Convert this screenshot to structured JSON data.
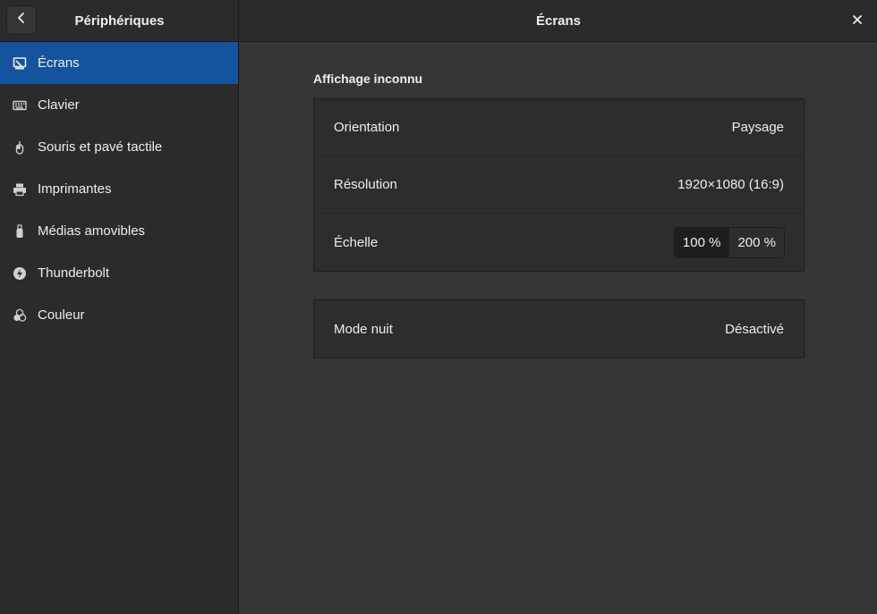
{
  "header": {
    "sidebar_title": "Périphériques",
    "main_title": "Écrans",
    "back_icon": "chevron-left-icon",
    "close_icon": "close-icon"
  },
  "sidebar": {
    "items": [
      {
        "label": "Écrans",
        "icon": "display-icon",
        "selected": true
      },
      {
        "label": "Clavier",
        "icon": "keyboard-icon",
        "selected": false
      },
      {
        "label": "Souris et pavé tactile",
        "icon": "mouse-icon",
        "selected": false
      },
      {
        "label": "Imprimantes",
        "icon": "printer-icon",
        "selected": false
      },
      {
        "label": "Médias amovibles",
        "icon": "usb-drive-icon",
        "selected": false
      },
      {
        "label": "Thunderbolt",
        "icon": "thunderbolt-icon",
        "selected": false
      },
      {
        "label": "Couleur",
        "icon": "color-icon",
        "selected": false
      }
    ]
  },
  "display": {
    "section_title": "Affichage inconnu",
    "orientation_label": "Orientation",
    "orientation_value": "Paysage",
    "resolution_label": "Résolution",
    "resolution_value": "1920×1080 (16:9)",
    "scale_label": "Échelle",
    "scale_options": [
      "100 %",
      "200 %"
    ],
    "scale_selected": "100 %"
  },
  "night": {
    "label": "Mode nuit",
    "value": "Désactivé"
  },
  "colors": {
    "accent": "#15539e",
    "background": "#353535",
    "sidebar": "#2b2b2b"
  }
}
